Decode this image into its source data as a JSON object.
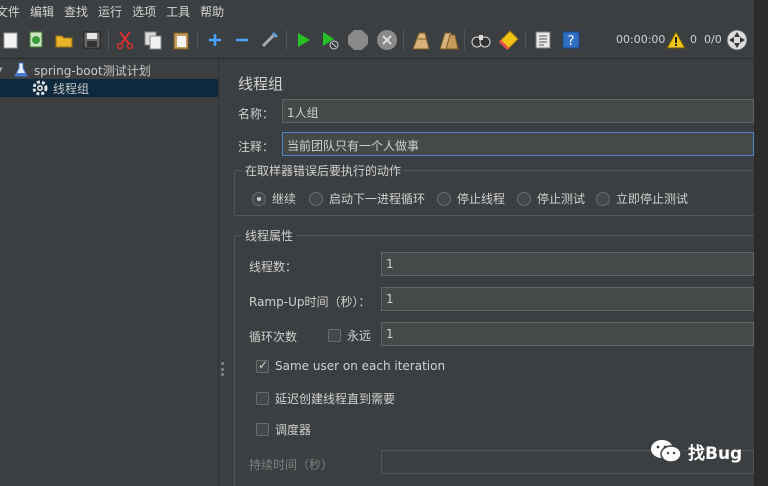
{
  "menu": [
    "文件",
    "编辑",
    "查找",
    "运行",
    "选项",
    "工具",
    "帮助"
  ],
  "toolbar": {
    "timer": "00:00:00",
    "warning_count": "0",
    "thread_count": "0/0",
    "colors": {
      "run": "#27c027",
      "warning": "#f2c417",
      "add": "#4aa3ff"
    }
  },
  "tree": {
    "root": {
      "label": "spring-boot测试计划",
      "icon": "flask-icon"
    },
    "child": {
      "label": "线程组",
      "icon": "gear-icon",
      "selected": true
    }
  },
  "panel": {
    "title": "线程组",
    "name_label": "名称：",
    "name_value": "1人组",
    "comment_label": "注释：",
    "comment_value": "当前团队只有一个人做事",
    "on_error": {
      "title": "在取样器错误后要执行的动作",
      "options": [
        "继续",
        "启动下一进程循环",
        "停止线程",
        "停止测试",
        "立即停止测试"
      ],
      "selected": "继续"
    },
    "thread_props": {
      "title": "线程属性",
      "threads_label": "线程数：",
      "threads_value": "1",
      "rampup_label": "Ramp-Up时间（秒）：",
      "rampup_value": "1",
      "loop_label": "循环次数",
      "forever_label": "永远",
      "forever_checked": false,
      "loop_value": "1",
      "same_user_label": "Same user on each iteration",
      "same_user_checked": true,
      "delay_label": "延迟创建线程直到需要",
      "delay_checked": false,
      "scheduler_label": "调度器",
      "scheduler_checked": false,
      "duration_label": "持续时间（秒）",
      "duration_value": ""
    }
  },
  "watermark": {
    "text": "找Bug",
    "icon": "wechat-icon"
  }
}
